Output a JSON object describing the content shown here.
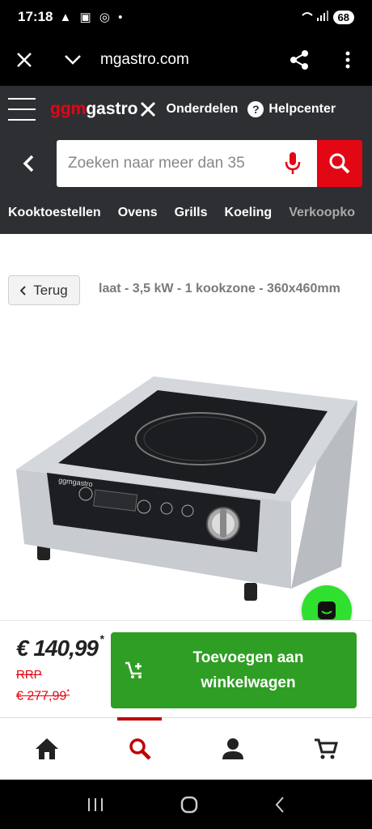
{
  "status_bar": {
    "time": "17:18",
    "battery": "68"
  },
  "browser": {
    "url": "mgastro.com"
  },
  "header": {
    "logo_prefix": "ggm",
    "logo_suffix": "gastro",
    "parts_link": "Onderdelen",
    "help_link": "Helpcenter",
    "search": {
      "placeholder": "Zoeken naar meer dan 35"
    },
    "categories": [
      "Kooktoestellen",
      "Ovens",
      "Grills",
      "Koeling",
      "Verkoopko"
    ]
  },
  "product": {
    "back_label": "Terug",
    "title": "laat - 3,5 kW - 1 kookzone - 360x460mm",
    "price": "€ 140,99",
    "price_mark": "*",
    "rrp_label": "RRP",
    "rrp_price": "€ 277,99",
    "rrp_mark": "*",
    "add_to_cart": "Toevoegen aan winkelwagen"
  },
  "colors": {
    "brand_red": "#e30613",
    "header_bg": "#2e2f33",
    "cart_green": "#2f9e24",
    "chat_green": "#2fe02f"
  },
  "bottom_nav": [
    "home-icon",
    "search-icon",
    "account-icon",
    "cart-icon"
  ]
}
